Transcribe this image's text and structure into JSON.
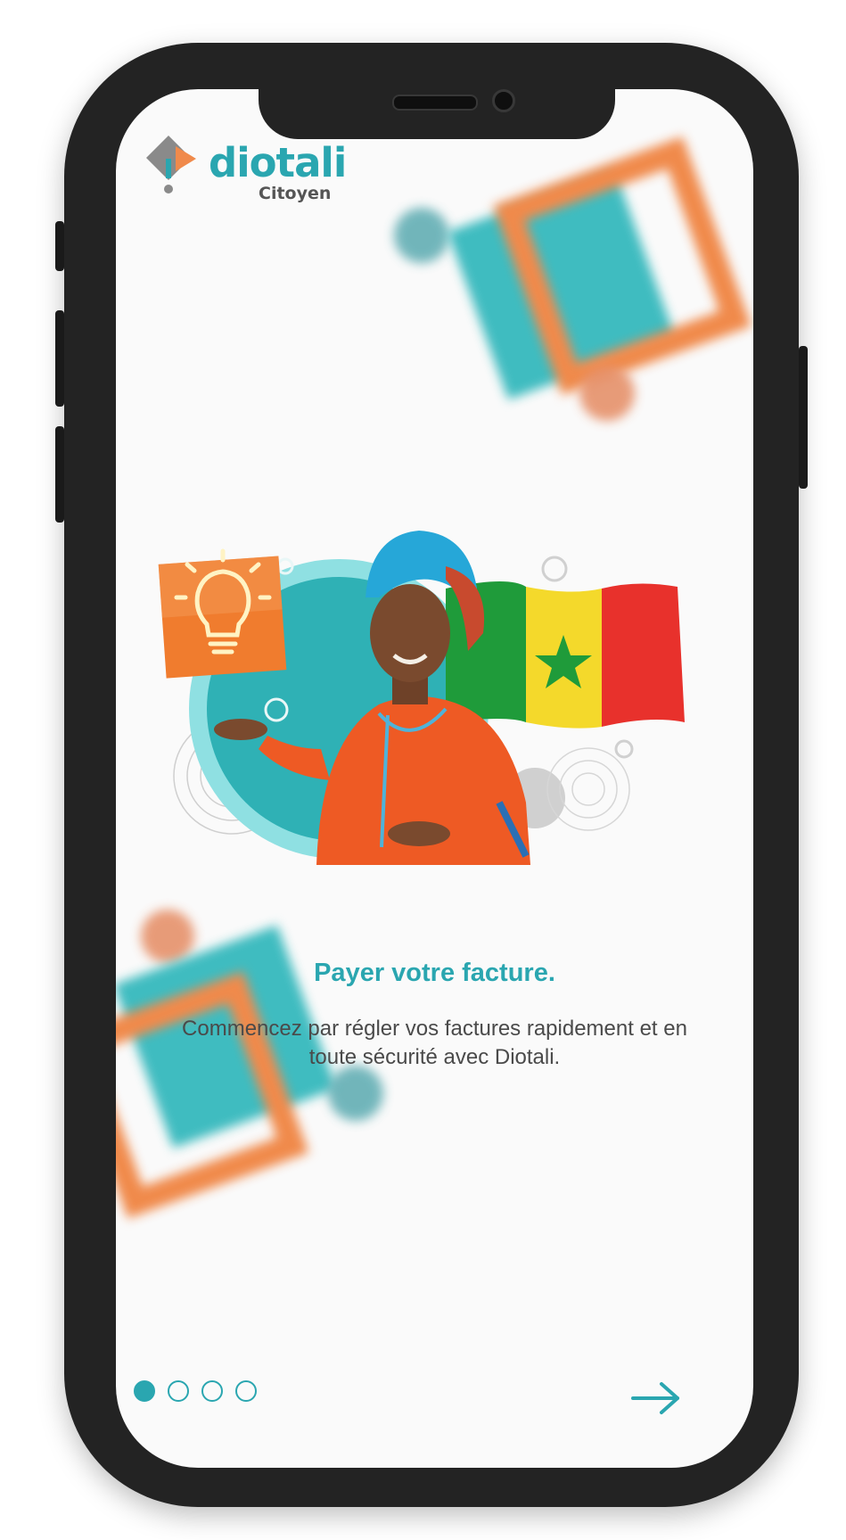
{
  "brand": {
    "name": "diotali",
    "subtitle": "Citoyen",
    "primary_color": "#2aa6b0",
    "accent_color": "#f08a4b"
  },
  "onboarding": {
    "title": "Payer votre facture.",
    "description": "Commencez par régler vos factures rapidement et en toute sécurité avec Diotali.",
    "current_step": 1,
    "total_steps": 4
  },
  "icons": {
    "next": "arrow-right-icon",
    "idea": "lightbulb-icon"
  }
}
